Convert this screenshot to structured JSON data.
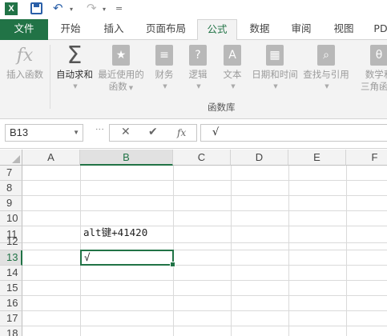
{
  "app": {
    "excel_logo": "X",
    "qat_dropdown": "▾",
    "qat_customize": "="
  },
  "tabs": [
    {
      "label": "文件"
    },
    {
      "label": "开始"
    },
    {
      "label": "插入"
    },
    {
      "label": "页面布局"
    },
    {
      "label": "公式",
      "active": true
    },
    {
      "label": "数据"
    },
    {
      "label": "审阅"
    },
    {
      "label": "视图"
    },
    {
      "label": "PD"
    }
  ],
  "ribbon": {
    "insert_function": {
      "label": "插入函数",
      "icon": "fx"
    },
    "autosum": {
      "label": "自动求和",
      "icon": "Σ"
    },
    "recent": {
      "label_line1": "最近使用的",
      "label_line2": "函数"
    },
    "financial": {
      "label": "财务"
    },
    "logical": {
      "label": "逻辑"
    },
    "text": {
      "label": "文本"
    },
    "datetime": {
      "label": "日期和时间"
    },
    "lookup": {
      "label": "查找与引用"
    },
    "math": {
      "label_line1": "数学和",
      "label_line2": "三角函数"
    },
    "group_label": "函数库"
  },
  "formula_bar": {
    "name_box": "B13",
    "fx": "fx",
    "formula": "√"
  },
  "sheet": {
    "columns": [
      "A",
      "B",
      "C",
      "D",
      "E",
      "F"
    ],
    "selected_column": "B",
    "rows": [
      "7",
      "8",
      "9",
      "10",
      "11",
      "12",
      "13",
      "14",
      "15",
      "16",
      "17",
      "18"
    ],
    "selected_row": "13",
    "cells": {
      "B11": "alt键+41420",
      "B13": "√"
    }
  }
}
